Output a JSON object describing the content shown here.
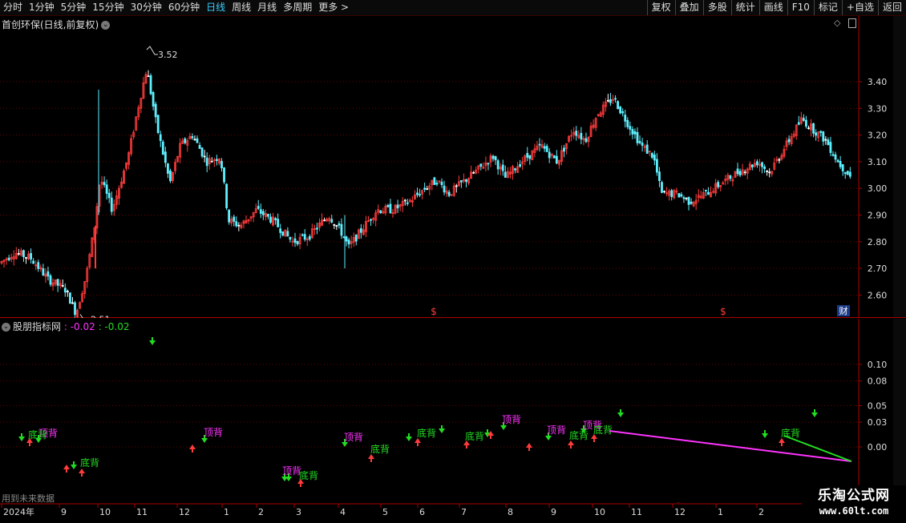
{
  "toolbar": {
    "periods": [
      "分时",
      "1分钟",
      "5分钟",
      "15分钟",
      "30分钟",
      "60分钟",
      "日线",
      "周线",
      "月线",
      "多周期",
      "更多"
    ],
    "active_period": "日线",
    "more_arrow": ">",
    "right_tools": [
      "复权",
      "叠加",
      "多股",
      "统计",
      "画线",
      "F10",
      "标记",
      "+自选",
      "返回"
    ]
  },
  "main_panel": {
    "title": "首创环保(日线,前复权)",
    "high_label": "3.52",
    "low_label": "2.51",
    "price_ticks": [
      "3.40",
      "3.30",
      "3.20",
      "3.10",
      "3.00",
      "2.90",
      "2.80",
      "2.70",
      "2.60"
    ],
    "dollar_marks": [
      "$",
      "$"
    ],
    "fin_badge": "财"
  },
  "indicator_panel": {
    "title": "股朋指标网",
    "values": [
      ": -0.02",
      ": -0.02"
    ],
    "ticks": [
      "0.10",
      "0.08",
      "0.05",
      "0.03",
      "0.00"
    ],
    "top_label": "顶背",
    "bottom_label": "底背"
  },
  "date_axis": [
    "2024年",
    "9",
    "10",
    "11",
    "12",
    "1",
    "2",
    "3",
    "4",
    "5",
    "6",
    "7",
    "8",
    "9",
    "10",
    "11",
    "12",
    "1",
    "2"
  ],
  "footer_note": "用到未来数据",
  "watermark": {
    "title": "乐淘公式网",
    "url": "www.60lt.com"
  },
  "colors": {
    "up": "#ff3b3b",
    "down": "#5ff0ff",
    "flat": "#ffffff",
    "green": "#22dd22",
    "magenta": "#ff33ff",
    "grid": "#6a0000",
    "axis": "#aa0000"
  }
}
